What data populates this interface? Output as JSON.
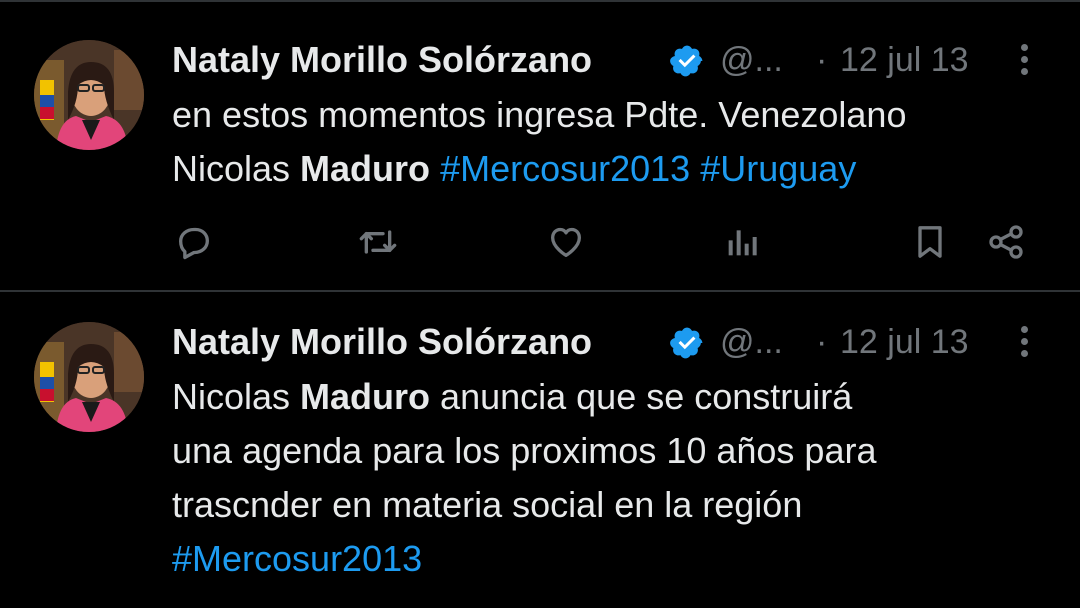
{
  "tweets": [
    {
      "name": "Nataly Morillo Solórzano",
      "handle": "@...",
      "dot": "·",
      "date": "12 jul 13",
      "text": [
        {
          "t": "en estos momentos ingresa Pdte. Venezolano",
          "style": "plain"
        },
        {
          "t": "\n",
          "style": "br"
        },
        {
          "t": "Nicolas ",
          "style": "plain"
        },
        {
          "t": "Maduro",
          "style": "bold"
        },
        {
          "t": " ",
          "style": "plain"
        },
        {
          "t": "#Mercosur2013",
          "style": "tag"
        },
        {
          "t": " ",
          "style": "plain"
        },
        {
          "t": "#Uruguay",
          "style": "tag"
        }
      ]
    },
    {
      "name": "Nataly Morillo Solórzano",
      "handle": "@...",
      "dot": "·",
      "date": "12 jul 13",
      "text": [
        {
          "t": "Nicolas ",
          "style": "plain"
        },
        {
          "t": "Maduro",
          "style": "bold"
        },
        {
          "t": " anuncia que se construirá",
          "style": "plain"
        },
        {
          "t": "\n",
          "style": "br"
        },
        {
          "t": "una agenda para los proximos 10 años para",
          "style": "plain"
        },
        {
          "t": "\n",
          "style": "br"
        },
        {
          "t": "trascnder en materia social en la región",
          "style": "plain"
        },
        {
          "t": "\n",
          "style": "br"
        },
        {
          "t": "#Mercosur2013",
          "style": "tag"
        }
      ]
    }
  ],
  "actions": [
    "reply-icon",
    "retweet-icon",
    "like-icon",
    "views-icon",
    "bookmark-icon",
    "share-icon"
  ],
  "colors": {
    "background": "#000000",
    "text": "#e7e9ea",
    "muted": "#71767b",
    "link": "#1d9bf0",
    "divider": "#2f3336"
  }
}
